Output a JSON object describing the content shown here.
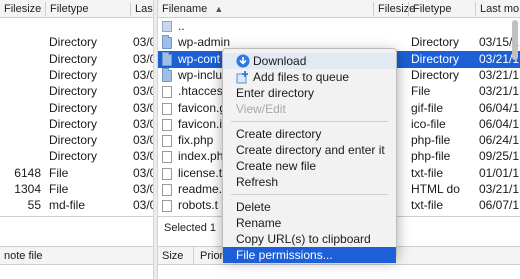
{
  "left_pane": {
    "columns": [
      "Filesize",
      "Filetype",
      "Last"
    ],
    "rows": [
      {
        "size": "",
        "type": ""
      },
      {
        "size": "",
        "type": "Directory",
        "date": "03/0"
      },
      {
        "size": "",
        "type": "Directory",
        "date": "03/0"
      },
      {
        "size": "",
        "type": "Directory",
        "date": "03/0"
      },
      {
        "size": "",
        "type": "Directory",
        "date": "03/0"
      },
      {
        "size": "",
        "type": "Directory",
        "date": "03/0"
      },
      {
        "size": "",
        "type": "Directory",
        "date": "03/0"
      },
      {
        "size": "",
        "type": "Directory",
        "date": "03/0"
      },
      {
        "size": "",
        "type": "Directory",
        "date": "03/0"
      },
      {
        "size": "6148",
        "type": "File",
        "date": "03/0"
      },
      {
        "size": "1304",
        "type": "File",
        "date": "03/0"
      },
      {
        "size": "55",
        "type": "md-file",
        "date": "03/0"
      }
    ],
    "status": "",
    "bottom_col": "note file"
  },
  "right_pane": {
    "columns": [
      "Filename",
      "Filesize",
      "Filetype",
      "Last mo"
    ],
    "sort_indicator": "▲",
    "rows": [
      {
        "name": "..",
        "size": "",
        "type": "",
        "date": "",
        "kind": "up"
      },
      {
        "name": "wp-admin",
        "size": "",
        "type": "Directory",
        "date": "03/15/1",
        "kind": "folder"
      },
      {
        "name": "wp-cont",
        "size": "",
        "type": "Directory",
        "date": "03/21/1",
        "kind": "folder",
        "selected": true
      },
      {
        "name": "wp-inclu",
        "size": "",
        "type": "Directory",
        "date": "03/21/1",
        "kind": "folder"
      },
      {
        "name": ".htacces",
        "size": "",
        "type": "File",
        "date": "03/21/1",
        "kind": "file"
      },
      {
        "name": "favicon.g",
        "size": "",
        "type": "gif-file",
        "date": "06/04/1",
        "kind": "file"
      },
      {
        "name": "favicon.i",
        "size": "",
        "type": "ico-file",
        "date": "06/04/1",
        "kind": "file"
      },
      {
        "name": "fix.php",
        "size": "",
        "type": "php-file",
        "date": "06/24/1",
        "kind": "file"
      },
      {
        "name": "index.ph",
        "size": "",
        "type": "php-file",
        "date": "09/25/1",
        "kind": "file"
      },
      {
        "name": "license.t",
        "size": "",
        "type": "txt-file",
        "date": "01/01/1",
        "kind": "file"
      },
      {
        "name": "readme.",
        "size": "",
        "type": "HTML do",
        "date": "03/21/1",
        "kind": "file"
      },
      {
        "name": "robots.t",
        "size": "",
        "type": "txt-file",
        "date": "06/07/1",
        "kind": "file"
      }
    ],
    "status": "Selected 1",
    "bottom_cols": [
      "Size",
      "Prior"
    ]
  },
  "context_menu": {
    "items": [
      {
        "label": "Download",
        "icon": "download-icon",
        "state": "highlighted"
      },
      {
        "label": "Add files to queue",
        "icon": "add-to-queue-icon",
        "state": "normal"
      },
      {
        "label": "Enter directory",
        "state": "normal"
      },
      {
        "label": "View/Edit",
        "state": "disabled"
      },
      {
        "separator": true
      },
      {
        "label": "Create directory",
        "state": "normal"
      },
      {
        "label": "Create directory and enter it",
        "state": "normal"
      },
      {
        "label": "Create new file",
        "state": "normal"
      },
      {
        "label": "Refresh",
        "state": "normal"
      },
      {
        "separator": true
      },
      {
        "label": "Delete",
        "state": "normal"
      },
      {
        "label": "Rename",
        "state": "normal"
      },
      {
        "label": "Copy URL(s) to clipboard",
        "state": "normal"
      },
      {
        "label": "File permissions...",
        "state": "selected"
      }
    ]
  },
  "colors": {
    "selection": "#1c5fd6",
    "menu_bg": "#f2f2f2",
    "disabled_text": "#a8a8a8"
  }
}
